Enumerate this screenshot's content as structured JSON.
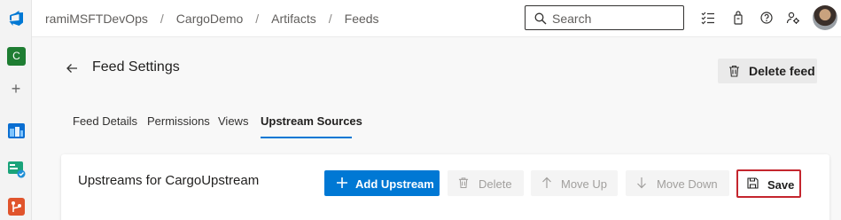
{
  "breadcrumb": {
    "items": [
      "ramiMSFTDevOps",
      "CargoDemo",
      "Artifacts",
      "Feeds"
    ],
    "separator": "/"
  },
  "search": {
    "placeholder": "Search"
  },
  "sidebar": {
    "project_initial": "C"
  },
  "page": {
    "title": "Feed Settings",
    "delete_feed_label": "Delete feed"
  },
  "tabs": [
    {
      "label": "Feed Details",
      "active": false
    },
    {
      "label": "Permissions",
      "active": false
    },
    {
      "label": "Views",
      "active": false
    },
    {
      "label": "Upstream Sources",
      "active": true
    }
  ],
  "card": {
    "title": "Upstreams for CargoUpstream",
    "buttons": {
      "add": "Add Upstream",
      "delete": "Delete",
      "move_up": "Move Up",
      "move_down": "Move Down",
      "save": "Save"
    }
  },
  "colors": {
    "accent": "#0078d4",
    "highlight_border": "#c4262e",
    "project_badge": "#1e7d32"
  }
}
